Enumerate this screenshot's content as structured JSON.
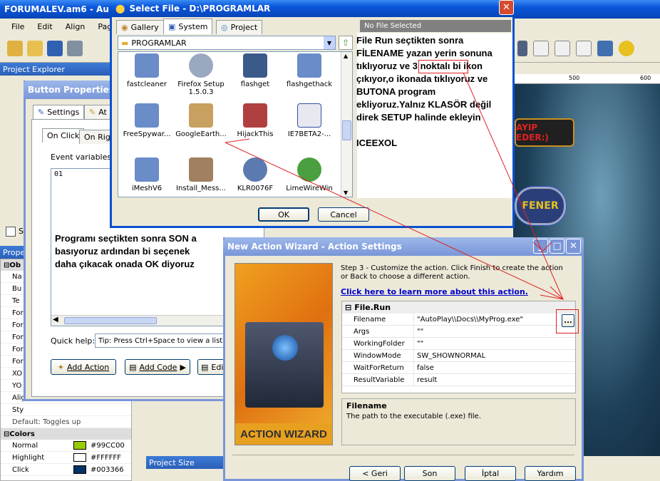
{
  "main": {
    "title": "FORUMALEV.am6 - Au",
    "menu": [
      "File",
      "Edit",
      "Align",
      "Page"
    ],
    "project_explorer": "Project Explorer",
    "properties": "Prope",
    "project_size": "Project Size",
    "ruler": [
      "500",
      "600"
    ],
    "canvas_button1": "AYIP EDER:)",
    "canvas_button2": "FENER",
    "checkbox_label": "S"
  },
  "button_props": {
    "title": "Button Properties:",
    "tabs": [
      "Settings",
      "At"
    ],
    "subtabs": [
      "On Click",
      "On Righ"
    ],
    "event_vars_label": "Event variables:",
    "code": "01",
    "quick_help_label": "Quick help:",
    "quick_help_value": "Tip: Press Ctrl+Space to view a list of",
    "add_action": "Add Action",
    "add_code": "Add Code",
    "edit": "Edi"
  },
  "props_panel": {
    "group": "Ob",
    "rows": [
      "Na",
      "Bu",
      "Te",
      "For",
      "For",
      "For",
      "For",
      "For",
      "XO",
      "YO",
      "Alig",
      "Sty"
    ],
    "default_text": "Default: Toggles up",
    "colors_header": "Colors",
    "colors": [
      {
        "name": "Normal",
        "value": "#99CC00",
        "swatch": "#99CC00"
      },
      {
        "name": "Highlight",
        "value": "#FFFFFF",
        "swatch": "#FFFFFF"
      },
      {
        "name": "Click",
        "value": "#003366",
        "swatch": "#003366"
      }
    ]
  },
  "select_file": {
    "title": "Select File - D:\\PROGRAMLAR",
    "tabs": [
      "Gallery",
      "System",
      "Project"
    ],
    "path": "PROGRAMLAR",
    "status": "No File Selected",
    "files": [
      {
        "name": "fastcleaner",
        "color": "#6a8cc8"
      },
      {
        "name": "Firefox Setup 1.5.0.3",
        "color": "#9aa8c0"
      },
      {
        "name": "flashget",
        "color": "#3a5a8a"
      },
      {
        "name": "flashgethack",
        "color": "#6a8cc8"
      },
      {
        "name": "FreeSpywar...",
        "color": "#6a8cc8"
      },
      {
        "name": "GoogleEarth...",
        "color": "#c8a060"
      },
      {
        "name": "HijackThis",
        "color": "#b04040"
      },
      {
        "name": "IE7BETA2-...",
        "color": "#e8e8f0"
      },
      {
        "name": "iMeshV6",
        "color": "#6a8cc8"
      },
      {
        "name": "Install_Mess...",
        "color": "#a08060"
      },
      {
        "name": "KLR0076F",
        "color": "#5a7ab0"
      },
      {
        "name": "LimeWireWin",
        "color": "#4aa040"
      }
    ],
    "ok": "OK",
    "cancel": "Cancel"
  },
  "annotations": {
    "text1_lines": [
      "File Run seçtikten sonra",
      "FİLENAME yazan yerin sonuna",
      "tıklıyoruz ve 3 noktalı bi ikon",
      "çıkıyor,o ikonada tıklıyoruz ve",
      "BUTONA program",
      "ekliyoruz.Yalnız KLASÖR değil",
      "direk SETUP halinde ekleyin"
    ],
    "signature": "ICEEXOL",
    "text2_lines": [
      "Programı seçtikten sonra SON a",
      "basıyoruz ardından bi seçenek",
      "daha çıkacak onada OK diyoruz"
    ]
  },
  "wizard": {
    "title": "New Action Wizard - Action Settings",
    "step_text": "Step 3 - Customize the action.  Click Finish to create the action or Back to choose a different action.",
    "learn_link": "Click here to learn more about this action.",
    "image_caption": "ACTION WIZARD",
    "group": "File.Run",
    "params": [
      {
        "name": "Filename",
        "value": "\"AutoPlay\\\\Docs\\\\MyProg.exe\""
      },
      {
        "name": "Args",
        "value": "\"\""
      },
      {
        "name": "WorkingFolder",
        "value": "\"\""
      },
      {
        "name": "WindowMode",
        "value": "SW_SHOWNORMAL"
      },
      {
        "name": "WaitForReturn",
        "value": "false"
      },
      {
        "name": "ResultVariable",
        "value": "result"
      }
    ],
    "ellipsis": "...",
    "help_title": "Filename",
    "help_text": "The path to the executable (.exe) file.",
    "buttons": [
      "< Geri",
      "Son",
      "İptal",
      "Yardım"
    ]
  }
}
